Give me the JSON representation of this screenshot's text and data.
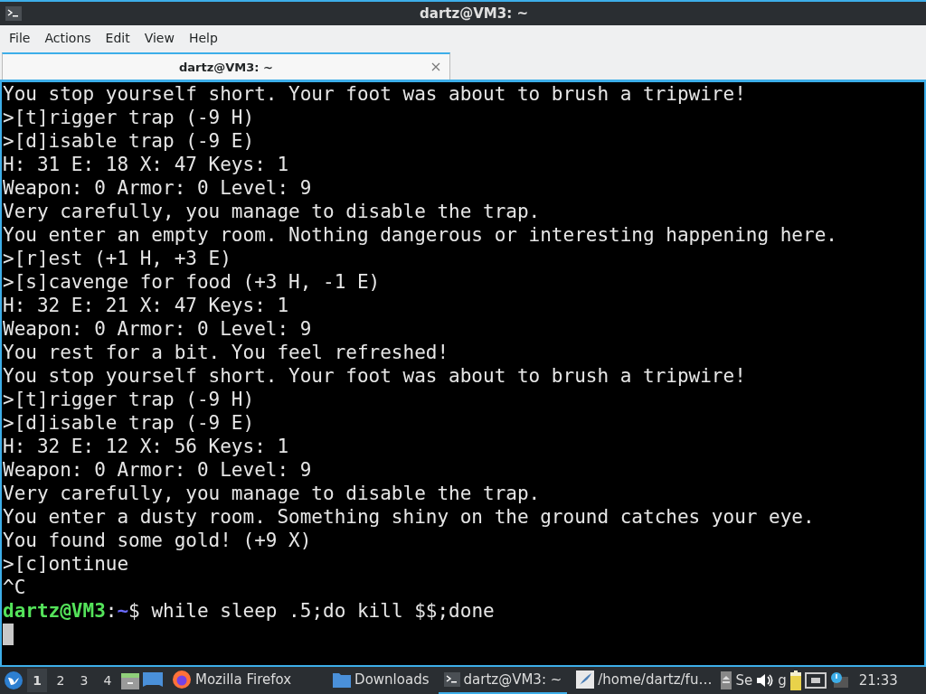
{
  "window": {
    "title": "dartz@VM3: ~"
  },
  "menu": [
    "File",
    "Actions",
    "Edit",
    "View",
    "Help"
  ],
  "tabs": [
    {
      "label": "dartz@VM3: ~",
      "selected": true
    }
  ],
  "terminal": {
    "lines": [
      "You stop yourself short. Your foot was about to brush a tripwire!",
      ">[t]rigger trap (-9 H)",
      ">[d]isable trap (-9 E)",
      "H: 31 E: 18 X: 47 Keys: 1",
      "Weapon: 0 Armor: 0 Level: 9",
      "Very carefully, you manage to disable the trap.",
      "You enter an empty room. Nothing dangerous or interesting happening here.",
      ">[r]est (+1 H, +3 E)",
      ">[s]cavenge for food (+3 H, -1 E)",
      "H: 32 E: 21 X: 47 Keys: 1",
      "Weapon: 0 Armor: 0 Level: 9",
      "You rest for a bit. You feel refreshed!",
      "You stop yourself short. Your foot was about to brush a tripwire!",
      ">[t]rigger trap (-9 H)",
      ">[d]isable trap (-9 E)",
      "H: 32 E: 12 X: 56 Keys: 1",
      "Weapon: 0 Armor: 0 Level: 9",
      "Very carefully, you manage to disable the trap.",
      "You enter a dusty room. Something shiny on the ground catches your eye.",
      "You found some gold! (+9 X)",
      ">[c]ontinue",
      "^C"
    ],
    "prompt": {
      "user": "dartz@VM3",
      "separator": ":",
      "path": "~",
      "command": "$ while sleep .5;do kill $$;done"
    }
  },
  "taskbar": {
    "workspaces": [
      {
        "label": "1",
        "selected": true
      },
      {
        "label": "2",
        "selected": false
      },
      {
        "label": "3",
        "selected": false
      },
      {
        "label": "4",
        "selected": false
      }
    ],
    "tasks": [
      {
        "kind": "firefox",
        "label": "Mozilla Firefox",
        "selected": false
      },
      {
        "kind": "folder",
        "label": "Downloads",
        "selected": false
      },
      {
        "kind": "terminal",
        "label": "dartz@VM3: ~",
        "selected": true
      },
      {
        "kind": "editor",
        "label": "/home/dartz/fu…",
        "selected": false
      }
    ],
    "tray": {
      "cut_1": "Se",
      "cut_2": "g"
    },
    "clock": "21:33"
  }
}
